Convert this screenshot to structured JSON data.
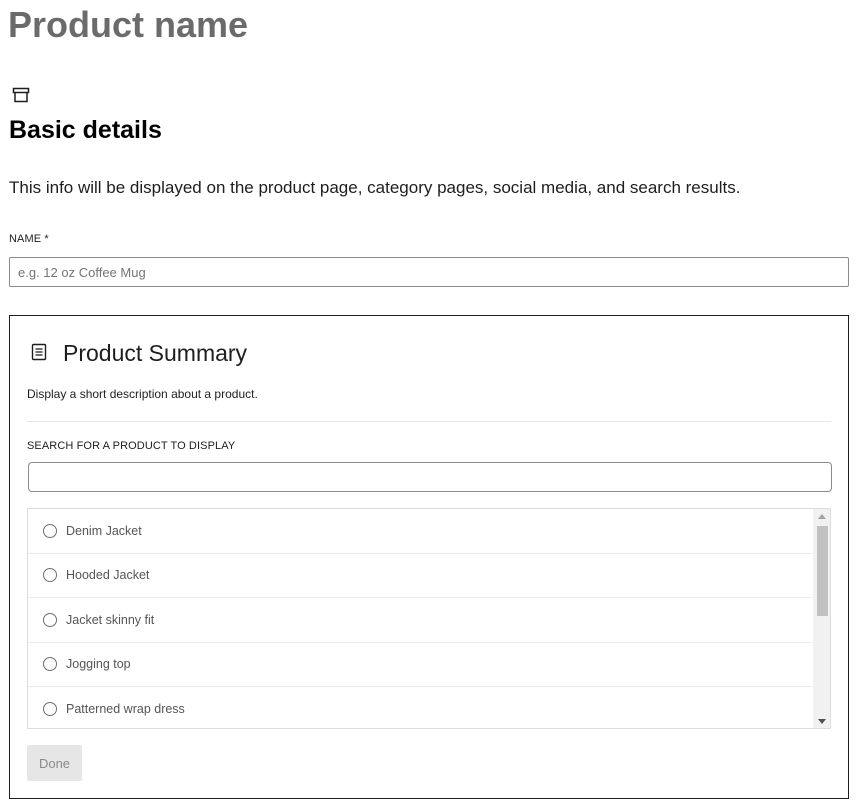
{
  "page": {
    "title": "Product name"
  },
  "basic_details": {
    "icon": "archive-icon",
    "title": "Basic details",
    "description": "This info will be displayed on the product page, category pages, social media, and search results.",
    "name_label": "NAME *",
    "name_placeholder": "e.g. 12 oz Coffee Mug",
    "name_value": ""
  },
  "product_summary": {
    "icon": "document-icon",
    "title": "Product Summary",
    "description": "Display a short description about a product.",
    "search_label": "SEARCH FOR A PRODUCT TO DISPLAY",
    "search_value": "",
    "products": [
      {
        "label": "Denim Jacket",
        "selected": false
      },
      {
        "label": "Hooded Jacket",
        "selected": false
      },
      {
        "label": "Jacket skinny fit",
        "selected": false
      },
      {
        "label": "Jogging top",
        "selected": false
      },
      {
        "label": "Patterned wrap dress",
        "selected": false
      }
    ],
    "done_label": "Done"
  },
  "colors": {
    "border_dark": "#1e1e1e",
    "input_border": "#8c8c8c",
    "title_gray": "#6b6b6b",
    "button_disabled_bg": "#e6e6e6"
  }
}
